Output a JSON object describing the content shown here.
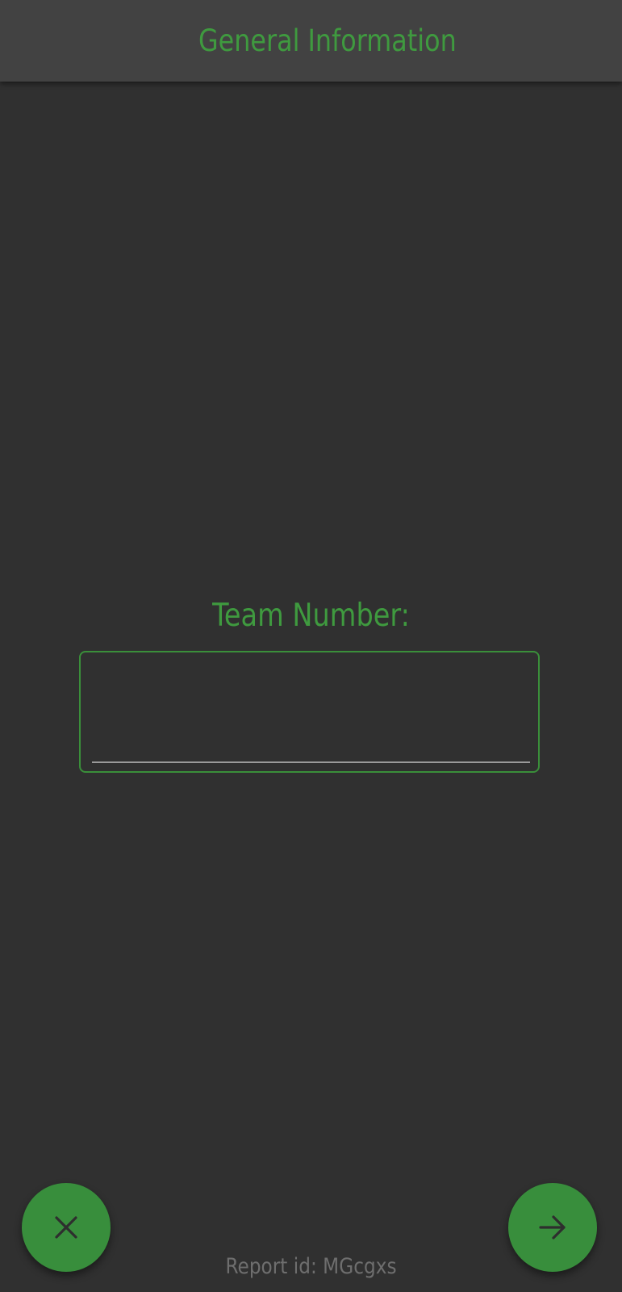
{
  "header": {
    "title": "General Information"
  },
  "form": {
    "team_number": {
      "label": "Team Number:",
      "value": "",
      "placeholder": ""
    }
  },
  "actions": {
    "close_icon": "close-icon",
    "next_icon": "arrow-right-icon"
  },
  "footer": {
    "report_id": "Report id: MGcgxs"
  },
  "colors": {
    "accent": "#388e3c",
    "background": "#303030",
    "app_bar": "#424242",
    "title_text": "#3f9a3f",
    "muted_text": "#6e6e6e"
  }
}
